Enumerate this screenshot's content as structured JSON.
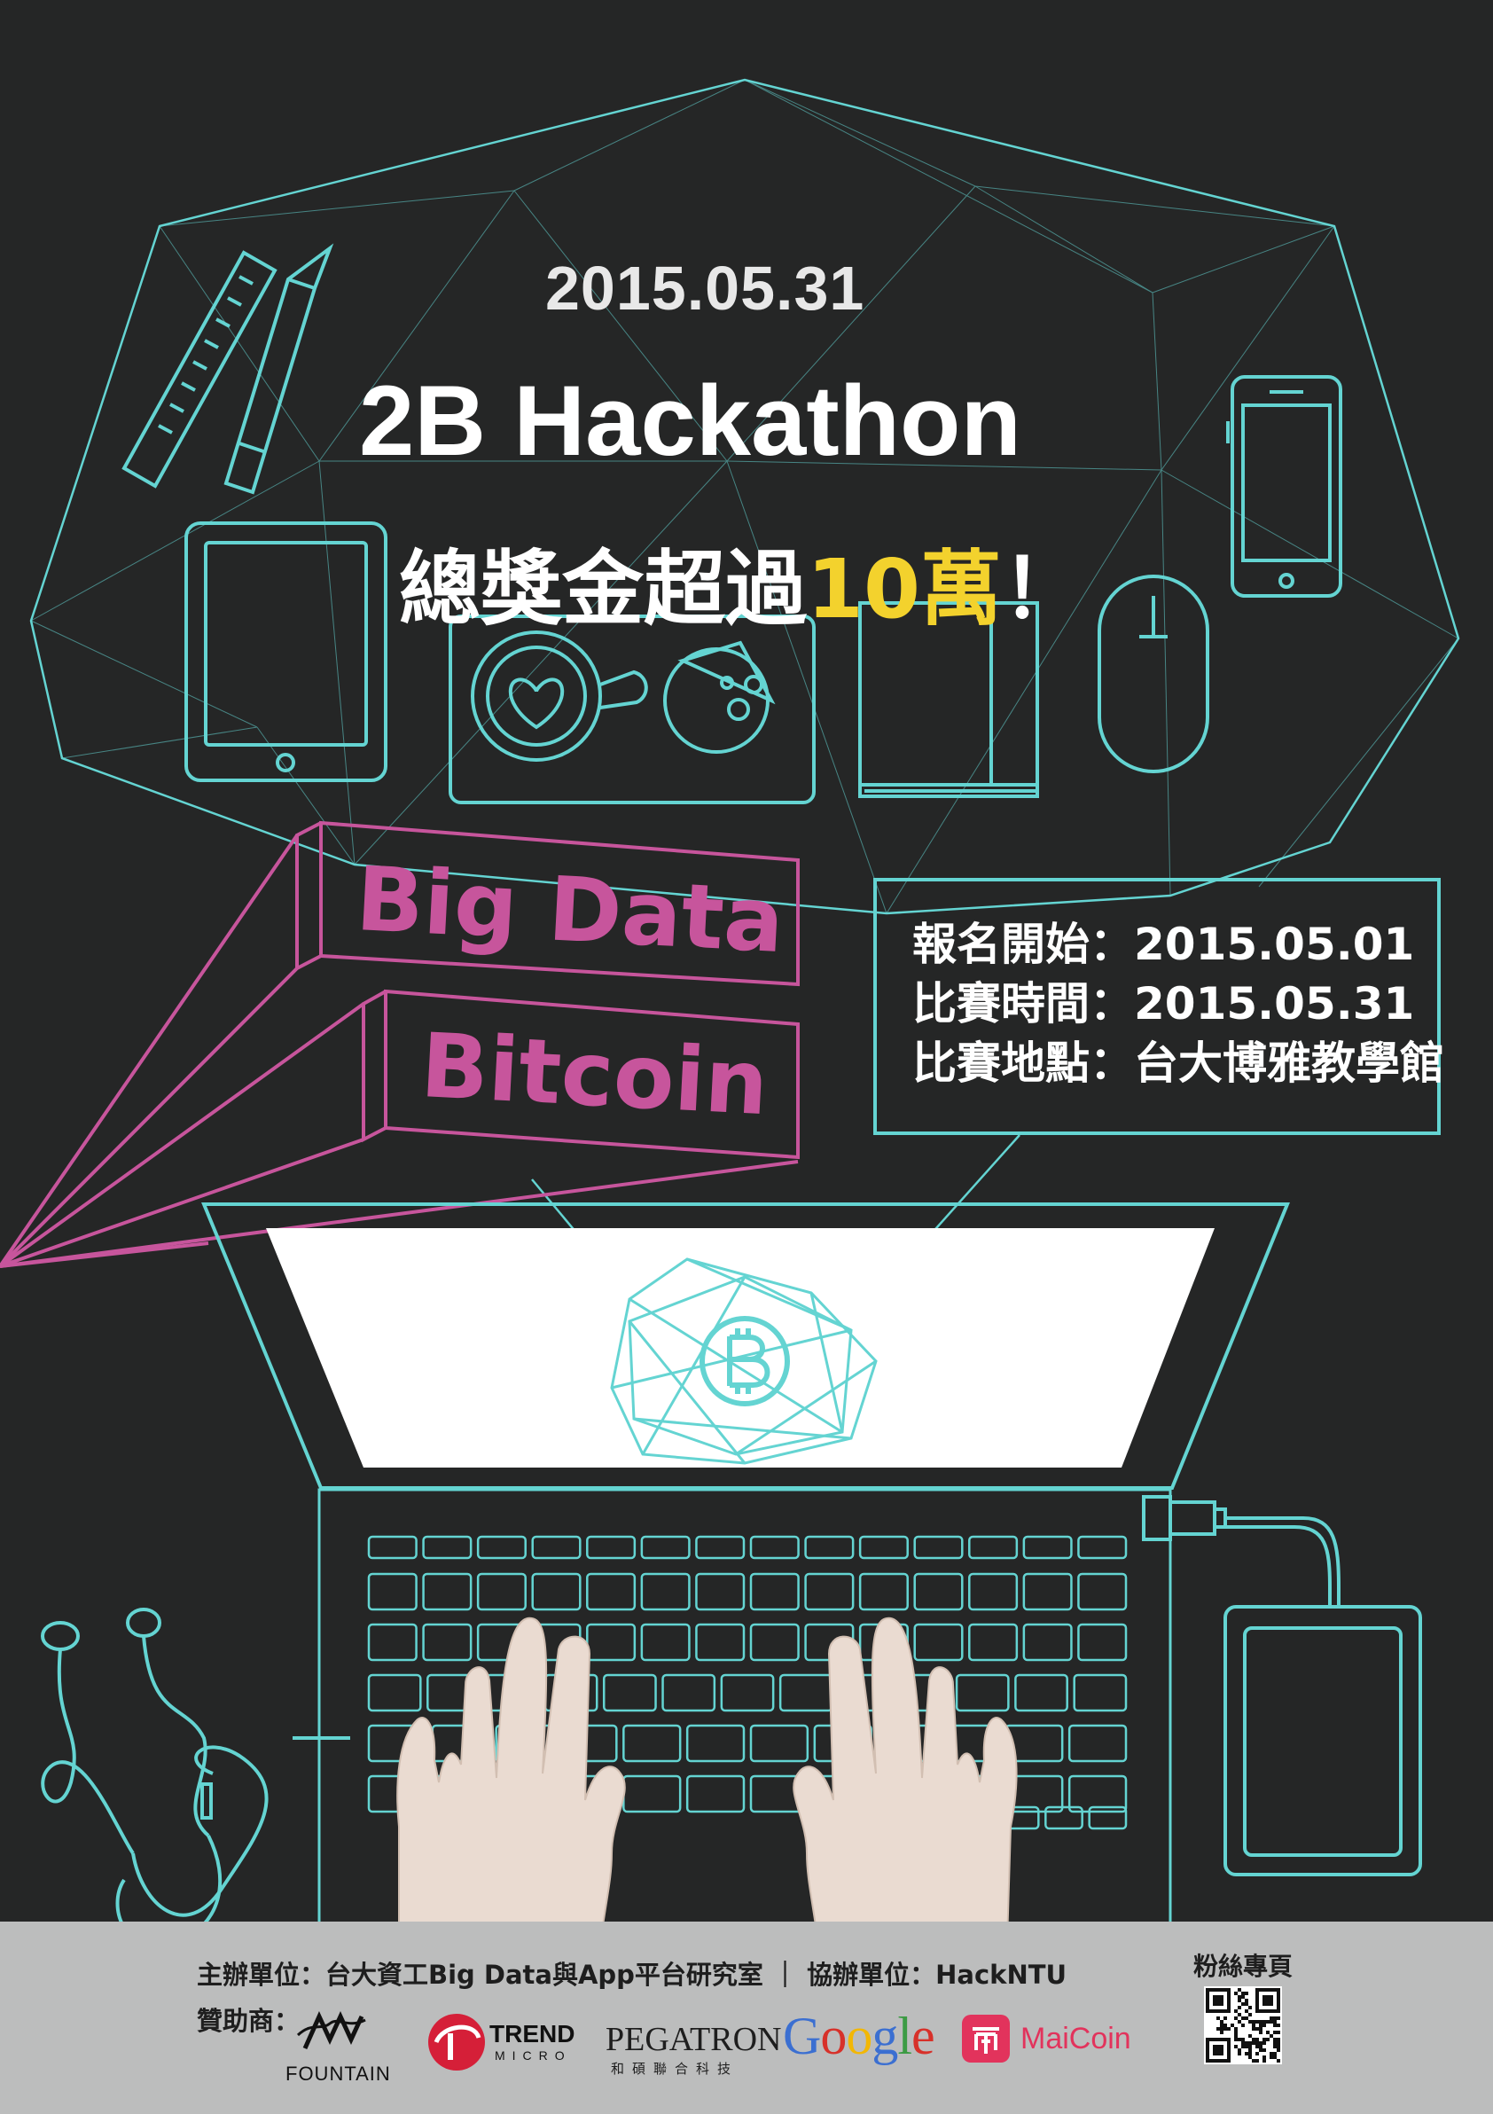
{
  "event": {
    "date": "2015.05.31",
    "title": "2B Hackathon",
    "prize_prefix": "總獎金超過",
    "prize_highlight": "10萬",
    "prize_suffix": "！"
  },
  "themes": [
    "Big Data",
    "Bitcoin"
  ],
  "info": [
    "報名開始：2015.05.01",
    "比賽時間：2015.05.31",
    "比賽地點：台大博雅教學館"
  ],
  "footer": {
    "organizer": "主辦單位：台大資工Big Data與App平台研究室 ｜ 協辦單位：HackNTU",
    "sponsor_label": "贊助商：",
    "fanpage_label": "粉絲專頁",
    "sponsors": {
      "fountain": "FOUNTAIN",
      "trend": "TREND",
      "trend_sub": "MICRO",
      "pegatron": "PEGATRON",
      "pegatron_sub": "和碩聯合科技",
      "google": [
        "G",
        "o",
        "o",
        "g",
        "l",
        "e"
      ],
      "maicoin": "MaiCoin"
    }
  },
  "colors": {
    "background": "#252626",
    "line": "#64d4d2",
    "magenta": "#c7559c",
    "highlight": "#f3d22d",
    "footer": "#bcbdbd",
    "google": [
      "#3b6fd1",
      "#d7312a",
      "#f2b705",
      "#3b6fd1",
      "#3c9b44",
      "#d7312a"
    ]
  },
  "icons": [
    "ruler-icon",
    "pencil-icon",
    "tablet-icon",
    "coffee-cup-icon",
    "pizza-icon",
    "notebook-icon",
    "mouse-icon",
    "smartphone-icon",
    "laptop-icon",
    "bitcoin-icon",
    "keyboard-icon",
    "hands-image",
    "earphones-icon",
    "usb-cable-icon",
    "power-bank-icon",
    "qr-code"
  ]
}
